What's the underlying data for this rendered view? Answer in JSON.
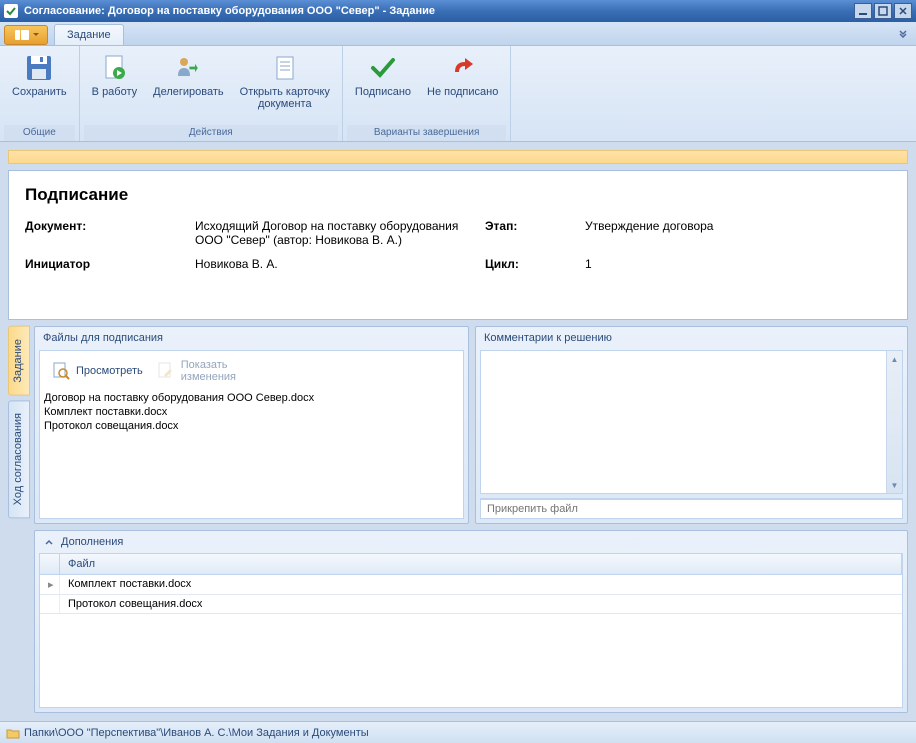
{
  "window": {
    "title": "Согласование: Договор на поставку оборудования ООО \"Север\" - Задание"
  },
  "ribbon": {
    "tab": "Задание",
    "groups": {
      "common": {
        "label": "Общие",
        "save": "Сохранить"
      },
      "actions": {
        "label": "Действия",
        "start": "В работу",
        "delegate": "Делегировать",
        "open_card": "Открыть карточку\nдокумента"
      },
      "complete": {
        "label": "Варианты завершения",
        "signed": "Подписано",
        "not_signed": "Не подписано"
      }
    }
  },
  "info": {
    "heading": "Подписание",
    "doc_label": "Документ:",
    "doc_value": "Исходящий Договор на поставку оборудования ООО \"Север\" (автор: Новикова В. А.)",
    "stage_label": "Этап:",
    "stage_value": "Утверждение договора",
    "initiator_label": "Инициатор",
    "initiator_value": "Новикова В. А.",
    "cycle_label": "Цикл:",
    "cycle_value": "1"
  },
  "side_tabs": {
    "task": "Задание",
    "progress": "Ход согласования"
  },
  "files": {
    "title": "Файлы для подписания",
    "view": "Просмотреть",
    "changes": "Показать\nизменения",
    "items": [
      "Договор на поставку оборудования ООО Север.docx",
      "Комплект поставки.docx",
      "Протокол совещания.docx"
    ]
  },
  "comments": {
    "title": "Комментарии к решению",
    "attach_placeholder": "Прикрепить файл"
  },
  "additions": {
    "title": "Дополнения",
    "column": "Файл",
    "rows": [
      "Комплект поставки.docx",
      "Протокол совещания.docx"
    ]
  },
  "statusbar": {
    "path": "Папки\\ООО \"Перспектива\"\\Иванов А. С.\\Мои Задания и Документы"
  }
}
